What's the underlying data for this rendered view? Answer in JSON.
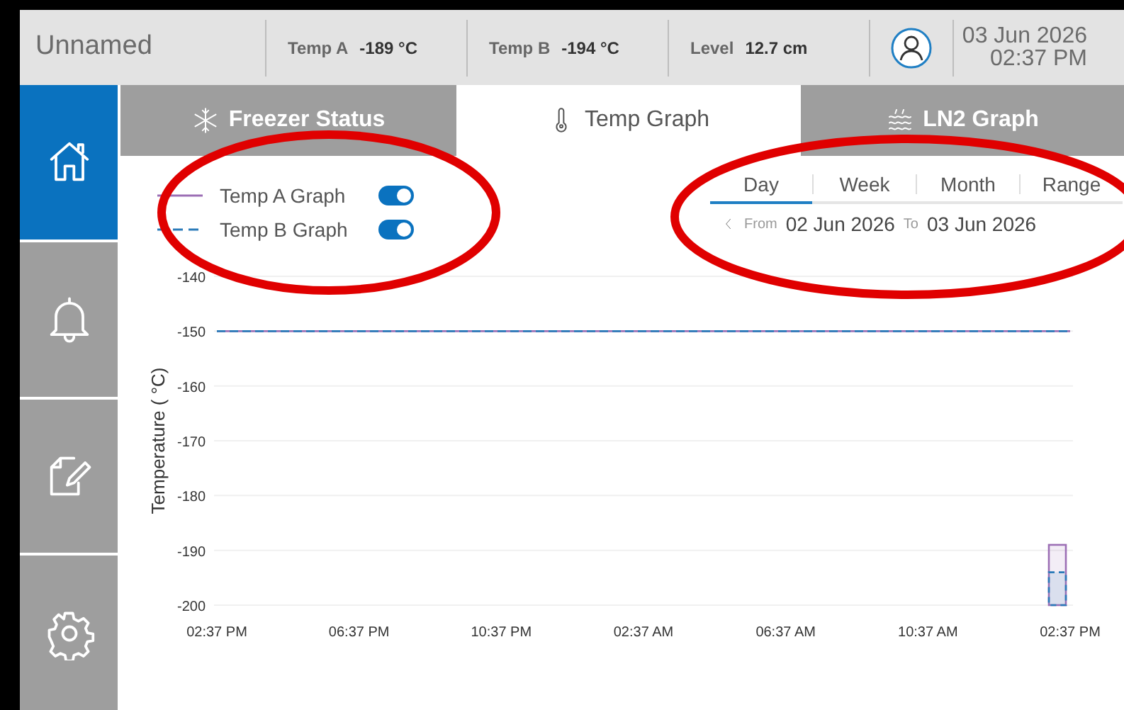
{
  "header": {
    "device_name": "Unnamed",
    "readings": [
      {
        "label": "Temp A",
        "value": "-189 °C"
      },
      {
        "label": "Temp B",
        "value": "-194 °C"
      },
      {
        "label": "Level",
        "value": "12.7 cm"
      }
    ],
    "date": "03 Jun 2026",
    "time": "02:37 PM"
  },
  "sidebar": {
    "items": [
      {
        "kind": "home",
        "selected": true
      },
      {
        "kind": "alarm",
        "selected": false
      },
      {
        "kind": "notes",
        "selected": false
      },
      {
        "kind": "settings",
        "selected": false
      }
    ]
  },
  "tabs": [
    {
      "kind": "freezer",
      "label": "Freezer Status",
      "selected": false
    },
    {
      "kind": "temp",
      "label": "Temp Graph",
      "selected": true
    },
    {
      "kind": "ln2",
      "label": "LN2 Graph",
      "selected": false
    }
  ],
  "legend": [
    {
      "on": true
    },
    {
      "on": true
    }
  ],
  "periods": [
    {
      "label": "Day",
      "selected": true
    },
    {
      "label": "Week",
      "selected": false
    },
    {
      "label": "Month",
      "selected": false
    },
    {
      "label": "Range",
      "selected": false
    }
  ],
  "date_range": {
    "from_label": "From",
    "from": "02 Jun 2026",
    "to_label": "To",
    "to": "03 Jun 2026"
  },
  "chart_data": {
    "type": "line",
    "ylabel": "Temperature ( °C)",
    "categories": [
      "02:37 PM",
      "06:37 PM",
      "10:37 PM",
      "02:37 AM",
      "06:37 AM",
      "10:37 AM",
      "02:37 PM"
    ],
    "series": [
      {
        "name": "Temp A Graph",
        "color": "#9c6fb5",
        "line_style": "solid",
        "values": [
          -150,
          -150,
          -150,
          -150,
          -150,
          -150,
          -150
        ]
      },
      {
        "name": "Temp B Graph",
        "color": "#2b7bb9",
        "line_style": "dashed",
        "values": [
          -150,
          -150,
          -150,
          -150,
          -150,
          -150,
          -150
        ]
      }
    ],
    "ylim": [
      -200,
      -140
    ],
    "grid": true,
    "yticks": [
      -140,
      -150,
      -160,
      -170,
      -180,
      -190,
      -200
    ]
  }
}
